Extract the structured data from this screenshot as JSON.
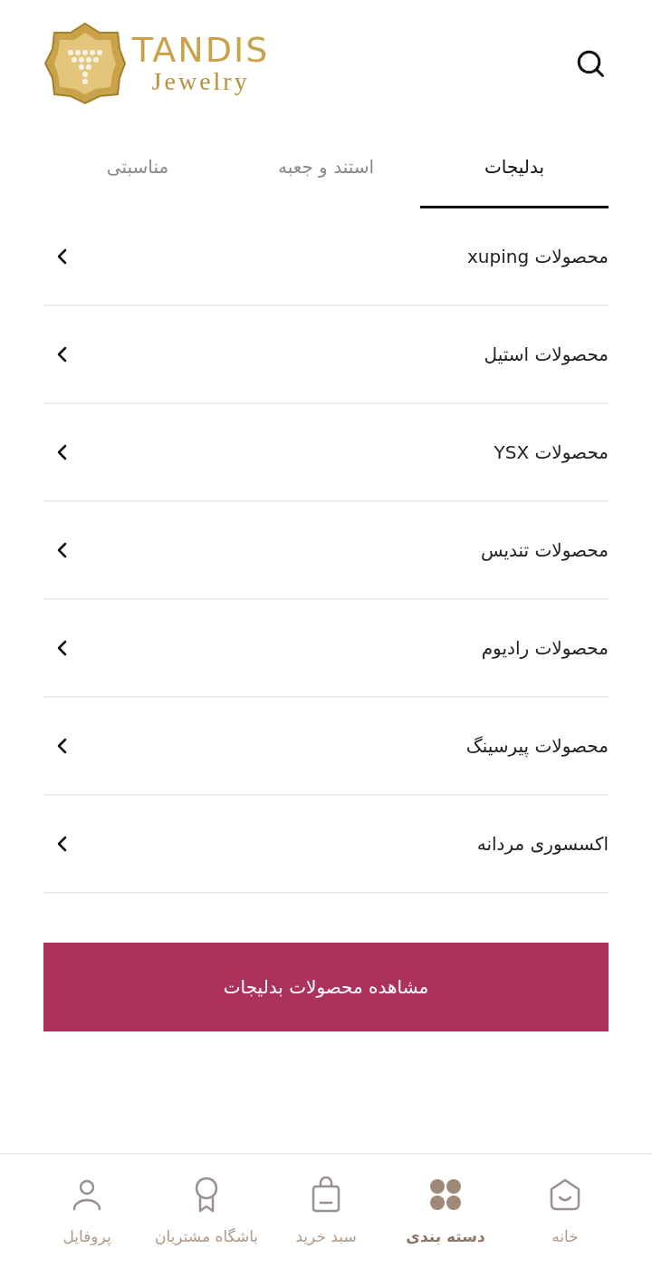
{
  "logo": {
    "title": "TANDIS",
    "subtitle": "Jewelry"
  },
  "tabs": [
    {
      "label": "بدلیجات",
      "selected": true
    },
    {
      "label": "استند و جعبه",
      "selected": false
    },
    {
      "label": "مناسبتی",
      "selected": false
    }
  ],
  "categories": [
    {
      "label": "محصولات xuping"
    },
    {
      "label": "محصولات استیل"
    },
    {
      "label": "محصولات YSX"
    },
    {
      "label": "محصولات تندیس"
    },
    {
      "label": "محصولات رادیوم"
    },
    {
      "label": "محصولات پیرسینگ"
    },
    {
      "label": "اکسسوری مردانه"
    }
  ],
  "view_all_button": "مشاهده محصولات بدلیجات",
  "bottom_nav": [
    {
      "kind": "home",
      "label": "خانه",
      "selected": false
    },
    {
      "kind": "grid",
      "label": "دسته بندی",
      "selected": true
    },
    {
      "kind": "bag",
      "label": "سبد خرید",
      "selected": false
    },
    {
      "kind": "award",
      "label": "باشگاه مشتریان",
      "selected": false
    },
    {
      "kind": "user",
      "label": "پروفایل",
      "selected": false
    }
  ]
}
